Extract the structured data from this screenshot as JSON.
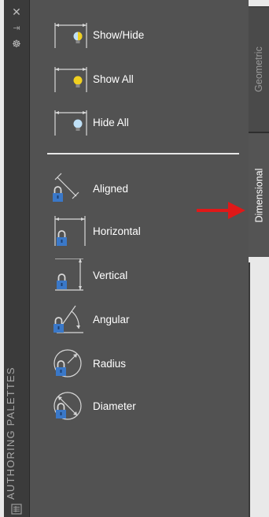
{
  "titlebar": {
    "title": "AUTHORING PALETTES",
    "buttons": {
      "close": "✕",
      "autohide": "⇥",
      "settings": "☸"
    }
  },
  "tools": [
    {
      "label": "Show/Hide",
      "icon": "show-hide-icon"
    },
    {
      "label": "Show All",
      "icon": "show-all-icon"
    },
    {
      "label": "Hide All",
      "icon": "hide-all-icon"
    },
    {
      "label": "Aligned",
      "icon": "aligned-dimension-icon"
    },
    {
      "label": "Horizontal",
      "icon": "horizontal-dimension-icon"
    },
    {
      "label": "Vertical",
      "icon": "vertical-dimension-icon"
    },
    {
      "label": "Angular",
      "icon": "angular-dimension-icon"
    },
    {
      "label": "Radius",
      "icon": "radius-dimension-icon"
    },
    {
      "label": "Diameter",
      "icon": "diameter-dimension-icon"
    }
  ],
  "tabs": [
    {
      "label": "Geometric",
      "active": false
    },
    {
      "label": "Dimensional",
      "active": true
    }
  ],
  "colors": {
    "panel": "#525252",
    "titlebar": "#3b3b3b",
    "arrow": "#e01818",
    "bulb_on": "#f0d020",
    "bulb_off": "#bfe0f6",
    "lock": "#3a78c8"
  }
}
